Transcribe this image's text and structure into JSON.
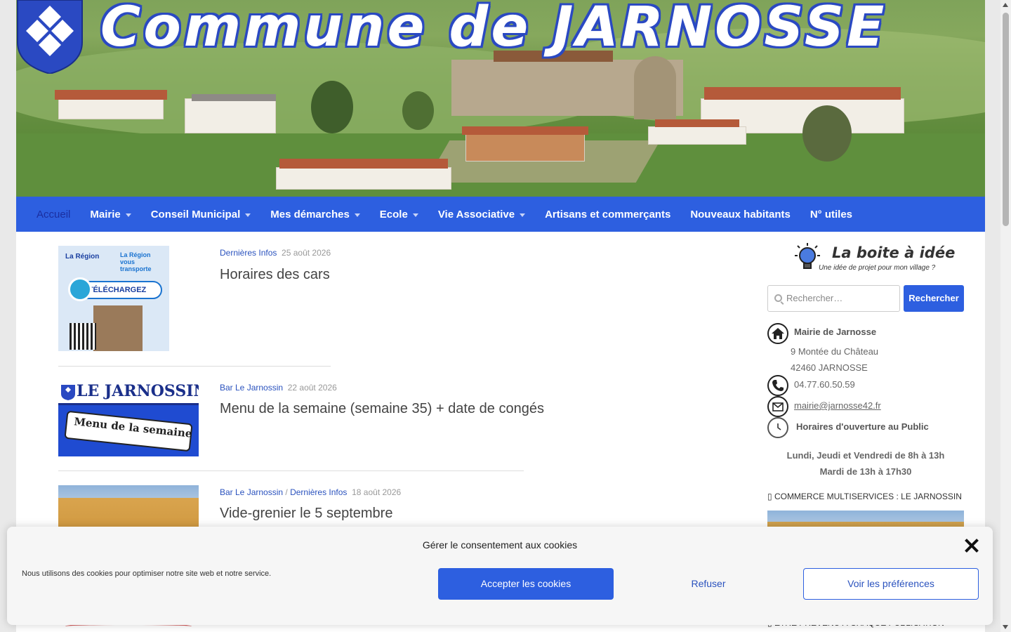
{
  "header": {
    "title": "Commune de JARNOSSE"
  },
  "nav": {
    "items": [
      {
        "label": "Accueil",
        "active": true,
        "dropdown": false
      },
      {
        "label": "Mairie",
        "dropdown": true
      },
      {
        "label": "Conseil Municipal",
        "dropdown": true
      },
      {
        "label": "Mes démarches",
        "dropdown": true
      },
      {
        "label": "Ecole",
        "dropdown": true
      },
      {
        "label": "Vie Associative",
        "dropdown": true
      },
      {
        "label": "Artisans et commerçants",
        "dropdown": false
      },
      {
        "label": "Nouveaux habitants",
        "dropdown": false
      },
      {
        "label": "N° utiles",
        "dropdown": false
      }
    ]
  },
  "posts": [
    {
      "categories": [
        "Dernières Infos"
      ],
      "date": "25 août 2026",
      "title": "Horaires des cars",
      "thumb": {
        "logo": "La Région",
        "logo_sub": "La Région vous transporte",
        "pill": "TÉLÉCHARGEZ"
      }
    },
    {
      "categories": [
        "Bar Le Jarnossin"
      ],
      "date": "22 août 2026",
      "title": "Menu de la semaine (semaine 35) + date de congés",
      "thumb": {
        "name": "LE JARNOSSIN",
        "ribbon": "Menu de la semaine"
      }
    },
    {
      "categories": [
        "Bar Le Jarnossin",
        "Dernières Infos"
      ],
      "date": "18 août 2026",
      "title": "Vide-grenier le 5 septembre"
    }
  ],
  "sidebar": {
    "idea_title": "La boite à idée",
    "idea_subtitle": "Une idée de projet pour mon village ?",
    "search_placeholder": "Rechercher…",
    "search_button": "Rechercher",
    "mairie_name": "Mairie de Jarnosse",
    "address_line1": "9 Montée du Château",
    "address_line2": "42460 JARNOSSE",
    "phone": "04.77.60.50.59",
    "email": "mairie@jarnosse42.fr",
    "hours_title": "Horaires d'ouverture au Public",
    "hours_line1": "Lundi, Jeudi et Vendredi de 8h à 13h",
    "hours_line2": "Mardi de 13h à 17h30",
    "commerce_heading": "COMMERCE MULTISERVICES : LE JARNOSSIN",
    "bottom_heading": "ÊTRE PRÉVENU À CHAQUE PUBLICATION"
  },
  "cookie": {
    "title": "Gérer le consentement aux cookies",
    "text": "Nous utilisons des cookies pour optimiser notre site web et notre service.",
    "accept": "Accepter les cookies",
    "refuse": "Refuser",
    "preferences": "Voir les préférences"
  },
  "colors": {
    "brand_blue": "#2d5fe0",
    "link_blue": "#2a52be",
    "header_title_stroke": "#2a49c2"
  }
}
